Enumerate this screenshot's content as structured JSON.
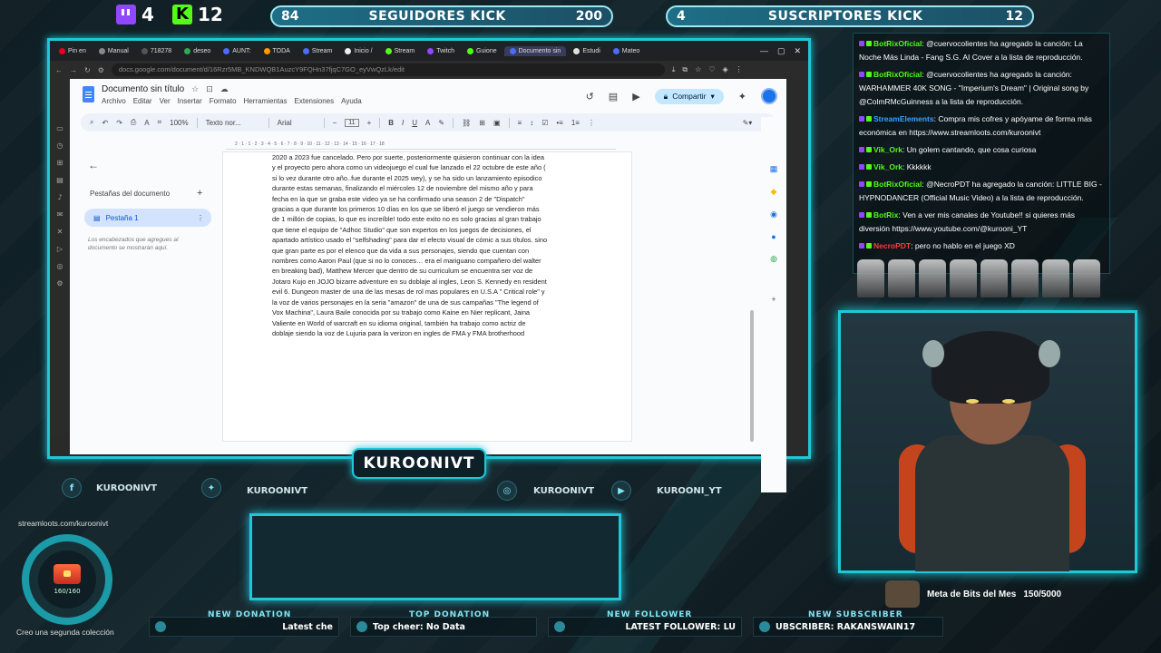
{
  "top": {
    "twitch_count": "4",
    "kick_count": "12",
    "followers": {
      "left": "84",
      "label": "SEGUIDORES KICK",
      "right": "200"
    },
    "subs": {
      "left": "4",
      "label": "SUSCRIPTORES KICK",
      "right": "12"
    }
  },
  "browser": {
    "tabs": [
      "Pin en",
      "Manual",
      "718278",
      "deseo",
      "AUNT:",
      "TODA",
      "Stream",
      "Inicio /",
      "Stream",
      "Twitch",
      "Guione",
      "Documento sin",
      "Estudi",
      "Mateo"
    ],
    "active_tab_index": 11,
    "url": "docs.google.com/document/d/16Rzr5MB_KNDWQB1AuzcY9FQHn37fjqC7GO_eyVwQzLk/edit"
  },
  "doc": {
    "title": "Documento sin título",
    "menu": [
      "Archivo",
      "Editar",
      "Ver",
      "Insertar",
      "Formato",
      "Herramientas",
      "Extensiones",
      "Ayuda"
    ],
    "share_label": "Compartir",
    "zoom": "100%",
    "style": "Texto nor...",
    "font": "Arial",
    "font_size": "11",
    "tabs_panel_title": "Pestañas del documento",
    "tab_name": "Pestaña 1",
    "tabs_hint": "Los encabezados que agregues al documento se mostrarán aquí.",
    "body_lines": [
      "2020 a 2023 fue cancelado. Pero por suerte, posteriormente quisieron continuar con la idea",
      "y el proyecto pero ahora como un videojuego el cual fue lanzado el 22 octubre de este año (",
      "si lo vez durante otro año..fue durante el 2025 wey), y se ha sido un lanzamiento episodico",
      "durante estas semanas, finalizando el miércoles 12 de noviembre  del mismo año y para",
      "fecha en la que se graba este video ya se ha confirmado una season 2 de \"Dispatch\"",
      "gracias a que durante los primeros 10 días en los que se liberó el juego se vendieron más",
      "de 1 millón de copias, lo que es increíble! todo este exito no es solo gracias al gran trabajo",
      "que tiene el equipo de \"Adhoc Studio\" que son expertos en los juegos de decisiones, el",
      "apartado artístico usado el \"selfshading\" para dar el efecto visual de cómic a sus títulos. sino",
      "que gran parte es por el elenco que da vida a sus personajes, siendo que cuentan con",
      "nombres como Aaron Paul (que si no lo conoces… era el mariguano compañero del walter",
      "en breaking bad), Matthew Mercer que dentro de su curriculum se encuentra ser voz de",
      "Jotaro Kujo en JOJO bizarre adventure en su doblaje al ingles, Leon S. Kennedy en resident",
      "evil 6. Dungeon master de una de las mesas de rol mas populares en U.S.A \" Critical role\" y",
      "la voz de varios personajes en la seria \"amazon\" de una de sus campañas \"The legend of",
      "Vox Machina\", Laura Baile conocida por su trabajo como Kaine en Nier replicant, Jaina",
      "Valiente en World of warcraft en su idioma original, también ha trabajo como actriz de",
      "doblaje siendo la voz de Lujuria para la verizon en ingles de FMA y FMA brotherhood"
    ]
  },
  "channel_name": "KUROONIVT",
  "socials": [
    {
      "icon": "facebook-icon",
      "label": "KUROONIVT"
    },
    {
      "icon": "twitter-icon",
      "label": "KUROONIVT"
    },
    {
      "icon": "instagram-icon",
      "label": "KUROONIVT"
    },
    {
      "icon": "youtube-icon",
      "label": "KUROONI_YT"
    }
  ],
  "streamloots": {
    "url": "streamloots.com/kuroonivt",
    "count": "160/160",
    "caption": "Creo una segunda colección"
  },
  "tickers": [
    {
      "label": "NEW DONATION",
      "text": "Latest che"
    },
    {
      "label": "TOP DONATION",
      "text": "Top cheer: No Data"
    },
    {
      "label": "NEW FOLLOWER",
      "text": "LATEST FOLLOWER: LU"
    },
    {
      "label": "NEW SUBSCRIBER",
      "text": "UBSCRIBER: RAKANSWAIN17"
    }
  ],
  "chat": [
    {
      "user": "BotRixOficial",
      "color": "green",
      "text": ": @cuervocolientes ha agregado la canción: La Noche Más Linda - Fang S.G. AI Cover a la lista de reproducción."
    },
    {
      "user": "BotRixOficial",
      "color": "green",
      "text": ": @cuervocolientes ha agregado la canción: WARHAMMER 40K SONG - \"Imperium's Dream\" | Original song by @ColmRMcGuinness a la lista de reproducción."
    },
    {
      "user": "StreamElements",
      "color": "blue",
      "text": ": Compra mis cofres y apóyame de forma más económica en https://www.streamloots.com/kuroonivt"
    },
    {
      "user": "Vik_Ork",
      "color": "green",
      "text": ": Un golem cantando, que cosa curiosa"
    },
    {
      "user": "Vik_Ork",
      "color": "green",
      "text": ": Kkkkkk"
    },
    {
      "user": "BotRixOficial",
      "color": "green",
      "text": ": @NecroPDT ha agregado la canción: LITTLE BIG - HYPNODANCER (Official Music Video) a la lista de reproducción."
    },
    {
      "user": "BotRix",
      "color": "green",
      "text": ": Ven a ver mis canales de Youtube!! si quieres más diversión https://www.youtube.com/@kurooni_YT"
    },
    {
      "user": "NecroPDT",
      "color": "red",
      "text": ": pero no hablo en el juego XD"
    }
  ],
  "bits_goal": {
    "label": "Meta de Bits del Mes",
    "value": "150/5000"
  },
  "colors": {
    "accent": "#1fc7d8",
    "kick": "#53fc18",
    "twitch": "#9146ff"
  }
}
